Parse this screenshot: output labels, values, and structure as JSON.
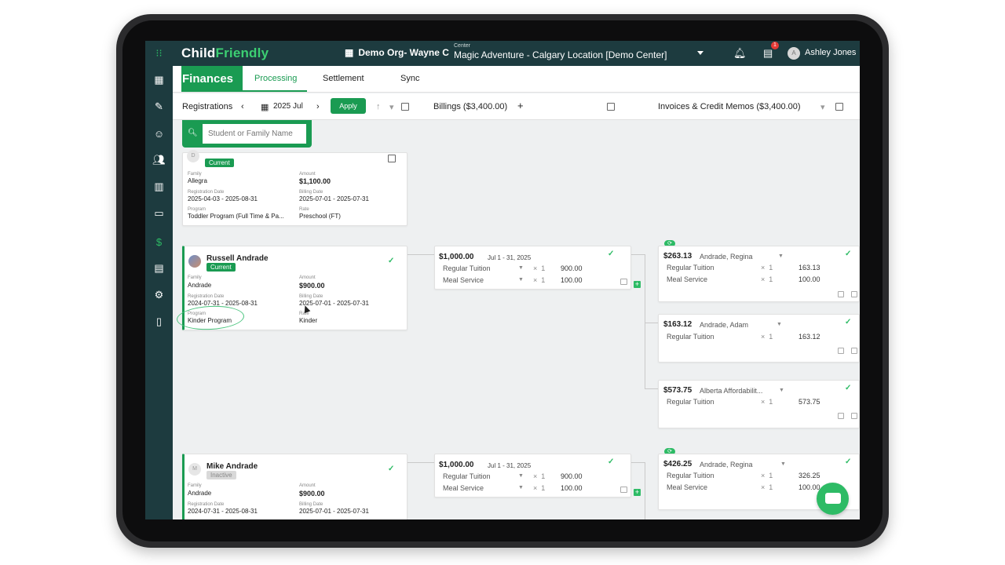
{
  "app": {
    "logo_part1": "Child",
    "logo_part2": "Friendly",
    "org": "Demo Org- Wayne C",
    "center_label": "Center",
    "center_value": "Magic Adventure - Calgary Location [Demo Center]",
    "notif_count": "1",
    "user_initial": "A",
    "user_name": "Ashley Jones"
  },
  "nav": {
    "title": "Finances",
    "tabs": [
      "Processing",
      "Settlement",
      "Sync"
    ]
  },
  "toolbar": {
    "registrations": "Registrations",
    "month": "2025 Jul",
    "apply": "Apply",
    "billings": "Billings ($3,400.00)",
    "invoices": "Invoices & Credit Memos ($3,400.00)"
  },
  "search": {
    "placeholder": "Student or Family Name"
  },
  "labels": {
    "family": "Family",
    "amount": "Amount",
    "registration_date": "Registration Date",
    "billing_date": "Billing Date",
    "program": "Program",
    "rate": "Rate",
    "x": "×"
  },
  "registrations": [
    {
      "initial": "D",
      "name": "",
      "status": "Current",
      "family": "Allegra",
      "amount": "$1,100.00",
      "reg_date": "2025-04-03 - 2025-08-31",
      "bill_date": "2025-07-01 - 2025-07-31",
      "program": "Toddler Program (Full Time & Pa...",
      "rate": "Preschool (FT)"
    },
    {
      "initial": "",
      "name": "Russell Andrade",
      "status": "Current",
      "family": "Andrade",
      "amount": "$900.00",
      "reg_date": "2024-07-31 - 2025-08-31",
      "bill_date": "2025-07-01 - 2025-07-31",
      "program": "Kinder Program",
      "rate": "Kinder"
    },
    {
      "initial": "M",
      "name": "Mike Andrade",
      "status": "Inactive",
      "family": "Andrade",
      "amount": "$900.00",
      "reg_date": "2024-07-31 - 2025-08-31",
      "bill_date": "2025-07-01 - 2025-07-31"
    }
  ],
  "billings": [
    {
      "amount": "$1,000.00",
      "period": "Jul 1 - 31, 2025",
      "lines": [
        {
          "name": "Regular Tuition",
          "qty": "1",
          "value": "900.00"
        },
        {
          "name": "Meal Service",
          "qty": "1",
          "value": "100.00"
        }
      ]
    },
    {
      "amount": "$1,000.00",
      "period": "Jul 1 - 31, 2025",
      "lines": [
        {
          "name": "Regular Tuition",
          "qty": "1",
          "value": "900.00"
        },
        {
          "name": "Meal Service",
          "qty": "1",
          "value": "100.00"
        }
      ]
    }
  ],
  "invoices": [
    {
      "amount": "$263.13",
      "who": "Andrade, Regina",
      "lines": [
        {
          "name": "Regular Tuition",
          "qty": "1",
          "value": "163.13"
        },
        {
          "name": "Meal Service",
          "qty": "1",
          "value": "100.00"
        }
      ]
    },
    {
      "amount": "$163.12",
      "who": "Andrade, Adam",
      "lines": [
        {
          "name": "Regular Tuition",
          "qty": "1",
          "value": "163.12"
        }
      ]
    },
    {
      "amount": "$573.75",
      "who": "Alberta Affordabilit...",
      "lines": [
        {
          "name": "Regular Tuition",
          "qty": "1",
          "value": "573.75"
        }
      ]
    },
    {
      "amount": "$426.25",
      "who": "Andrade, Regina",
      "lines": [
        {
          "name": "Regular Tuition",
          "qty": "1",
          "value": "326.25"
        },
        {
          "name": "Meal Service",
          "qty": "1",
          "value": "100.00"
        }
      ]
    }
  ],
  "colors": {
    "brand": "#1a9b52",
    "topbar": "#1d3b3f",
    "accent": "#2dbb65"
  }
}
